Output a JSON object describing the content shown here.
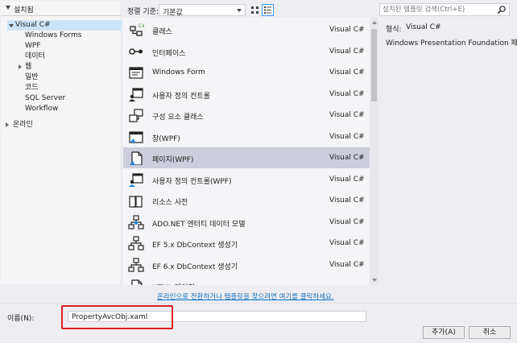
{
  "tree": {
    "header": "설치됨",
    "nodes": [
      {
        "label": "Visual C#"
      },
      {
        "label": "Windows Forms"
      },
      {
        "label": "WPF"
      },
      {
        "label": "데이터"
      },
      {
        "label": "웹"
      },
      {
        "label": "일반"
      },
      {
        "label": "코드"
      },
      {
        "label": "SQL Server"
      },
      {
        "label": "Workflow"
      },
      {
        "label": "온라인"
      }
    ]
  },
  "sort": {
    "label": "정렬 기준:",
    "value": "기본값"
  },
  "search": {
    "placeholder": "설치된 템플릿 검색(Ctrl+E)"
  },
  "templates": [
    {
      "name": "클래스",
      "lang": "Visual C#",
      "icon": "class-icon"
    },
    {
      "name": "인터페이스",
      "lang": "Visual C#",
      "icon": "interface-icon"
    },
    {
      "name": "Windows Form",
      "lang": "Visual C#",
      "icon": "windows-form-icon"
    },
    {
      "name": "사용자 정의 컨트롤",
      "lang": "Visual C#",
      "icon": "user-control-icon"
    },
    {
      "name": "구성 요소 클래스",
      "lang": "Visual C#",
      "icon": "component-class-icon"
    },
    {
      "name": "창(WPF)",
      "lang": "Visual C#",
      "icon": "wpf-window-icon"
    },
    {
      "name": "페이지(WPF)",
      "lang": "Visual C#",
      "icon": "wpf-page-icon"
    },
    {
      "name": "사용자 정의 컨트롤(WPF)",
      "lang": "Visual C#",
      "icon": "wpf-user-control-icon"
    },
    {
      "name": "리소스 사전",
      "lang": "Visual C#",
      "icon": "resource-dictionary-icon"
    },
    {
      "name": "ADO.NET 엔터티 데이터 모델",
      "lang": "Visual C#",
      "icon": "entity-data-model-icon"
    },
    {
      "name": "EF 5.x DbContext 생성기",
      "lang": "Visual C#",
      "icon": "dbcontext-icon"
    },
    {
      "name": "EF 6.x DbContext 생성기",
      "lang": "Visual C#",
      "icon": "dbcontext-icon"
    },
    {
      "name": "HTML 페이지",
      "lang": "",
      "icon": "html-page-icon"
    }
  ],
  "selected_index": 6,
  "details": {
    "type_label": "형식:",
    "type_value": "Visual C#",
    "description": "Windows Presentation Foundation 페이지"
  },
  "online_link": "온라인으로 전환하거나 템플릿을 찾으려면 여기를 클릭하세요.",
  "name_field": {
    "label": "이름(N):",
    "value": "PropertyAvcObj.xaml"
  },
  "buttons": {
    "add": "추가(A)",
    "cancel": "취소"
  },
  "colors": {
    "selection": "#cccedb",
    "link": "#0e70c0",
    "highlight": "#e21b24",
    "accent": "#3399ff"
  }
}
